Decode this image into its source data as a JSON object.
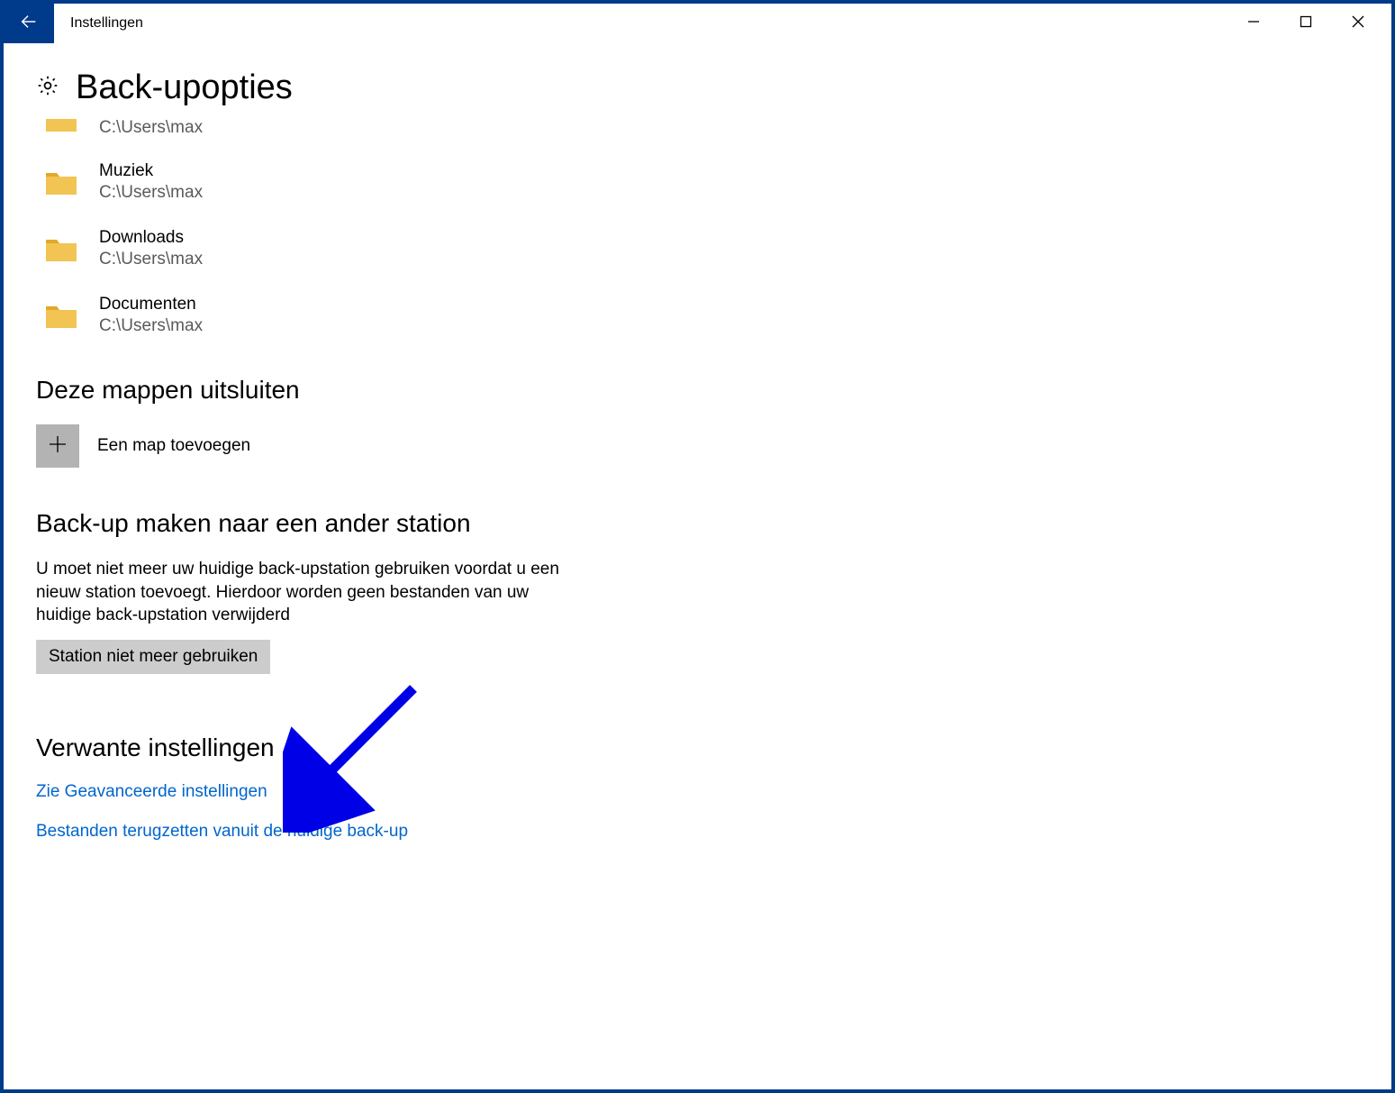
{
  "window": {
    "title": "Instellingen"
  },
  "page": {
    "heading": "Back-upopties"
  },
  "folders": [
    {
      "name": "",
      "path": "C:\\Users\\max",
      "partial": true
    },
    {
      "name": "Muziek",
      "path": "C:\\Users\\max"
    },
    {
      "name": "Downloads",
      "path": "C:\\Users\\max"
    },
    {
      "name": "Documenten",
      "path": "C:\\Users\\max"
    }
  ],
  "exclude": {
    "heading": "Deze mappen uitsluiten",
    "add_label": "Een map toevoegen"
  },
  "other_drive": {
    "heading": "Back-up maken naar een ander station",
    "description": "U moet niet meer uw huidige back-upstation gebruiken voordat u een nieuw station toevoegt. Hierdoor worden geen bestanden van uw huidige back-upstation verwijderd",
    "button": "Station niet meer gebruiken"
  },
  "related": {
    "heading": "Verwante instellingen",
    "links": [
      "Zie Geavanceerde instellingen",
      "Bestanden terugzetten vanuit de huidige back-up"
    ]
  }
}
